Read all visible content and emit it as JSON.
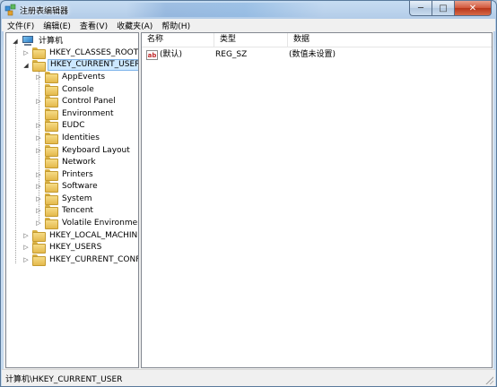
{
  "window": {
    "title": "注册表编辑器"
  },
  "caption": {
    "minimize": "─",
    "maximize": "□",
    "close": "✕"
  },
  "menu": [
    {
      "label": "文件(F)"
    },
    {
      "label": "编辑(E)"
    },
    {
      "label": "查看(V)"
    },
    {
      "label": "收藏夹(A)"
    },
    {
      "label": "帮助(H)"
    }
  ],
  "tree": {
    "root": "计算机",
    "hives": [
      {
        "label": "HKEY_CLASSES_ROOT",
        "expanded": false
      },
      {
        "label": "HKEY_CURRENT_USER",
        "expanded": true,
        "selected": true
      },
      {
        "label": "HKEY_LOCAL_MACHINE",
        "expanded": false
      },
      {
        "label": "HKEY_USERS",
        "expanded": false
      },
      {
        "label": "HKEY_CURRENT_CONFIG",
        "expanded": false
      }
    ],
    "current_user_children": [
      {
        "label": "AppEvents",
        "has_children": true
      },
      {
        "label": "Console",
        "has_children": false
      },
      {
        "label": "Control Panel",
        "has_children": true
      },
      {
        "label": "Environment",
        "has_children": false
      },
      {
        "label": "EUDC",
        "has_children": true
      },
      {
        "label": "Identities",
        "has_children": true
      },
      {
        "label": "Keyboard Layout",
        "has_children": true
      },
      {
        "label": "Network",
        "has_children": false
      },
      {
        "label": "Printers",
        "has_children": true
      },
      {
        "label": "Software",
        "has_children": true
      },
      {
        "label": "System",
        "has_children": true
      },
      {
        "label": "Tencent",
        "has_children": true
      },
      {
        "label": "Volatile Environment",
        "has_children": true
      }
    ]
  },
  "list": {
    "columns": {
      "name": "名称",
      "type": "类型",
      "data": "数据"
    },
    "rows": [
      {
        "name": "(默认)",
        "type": "REG_SZ",
        "data": "(数值未设置)",
        "icon": "string-value-icon"
      }
    ]
  },
  "status": {
    "path": "计算机\\HKEY_CURRENT_USER"
  }
}
